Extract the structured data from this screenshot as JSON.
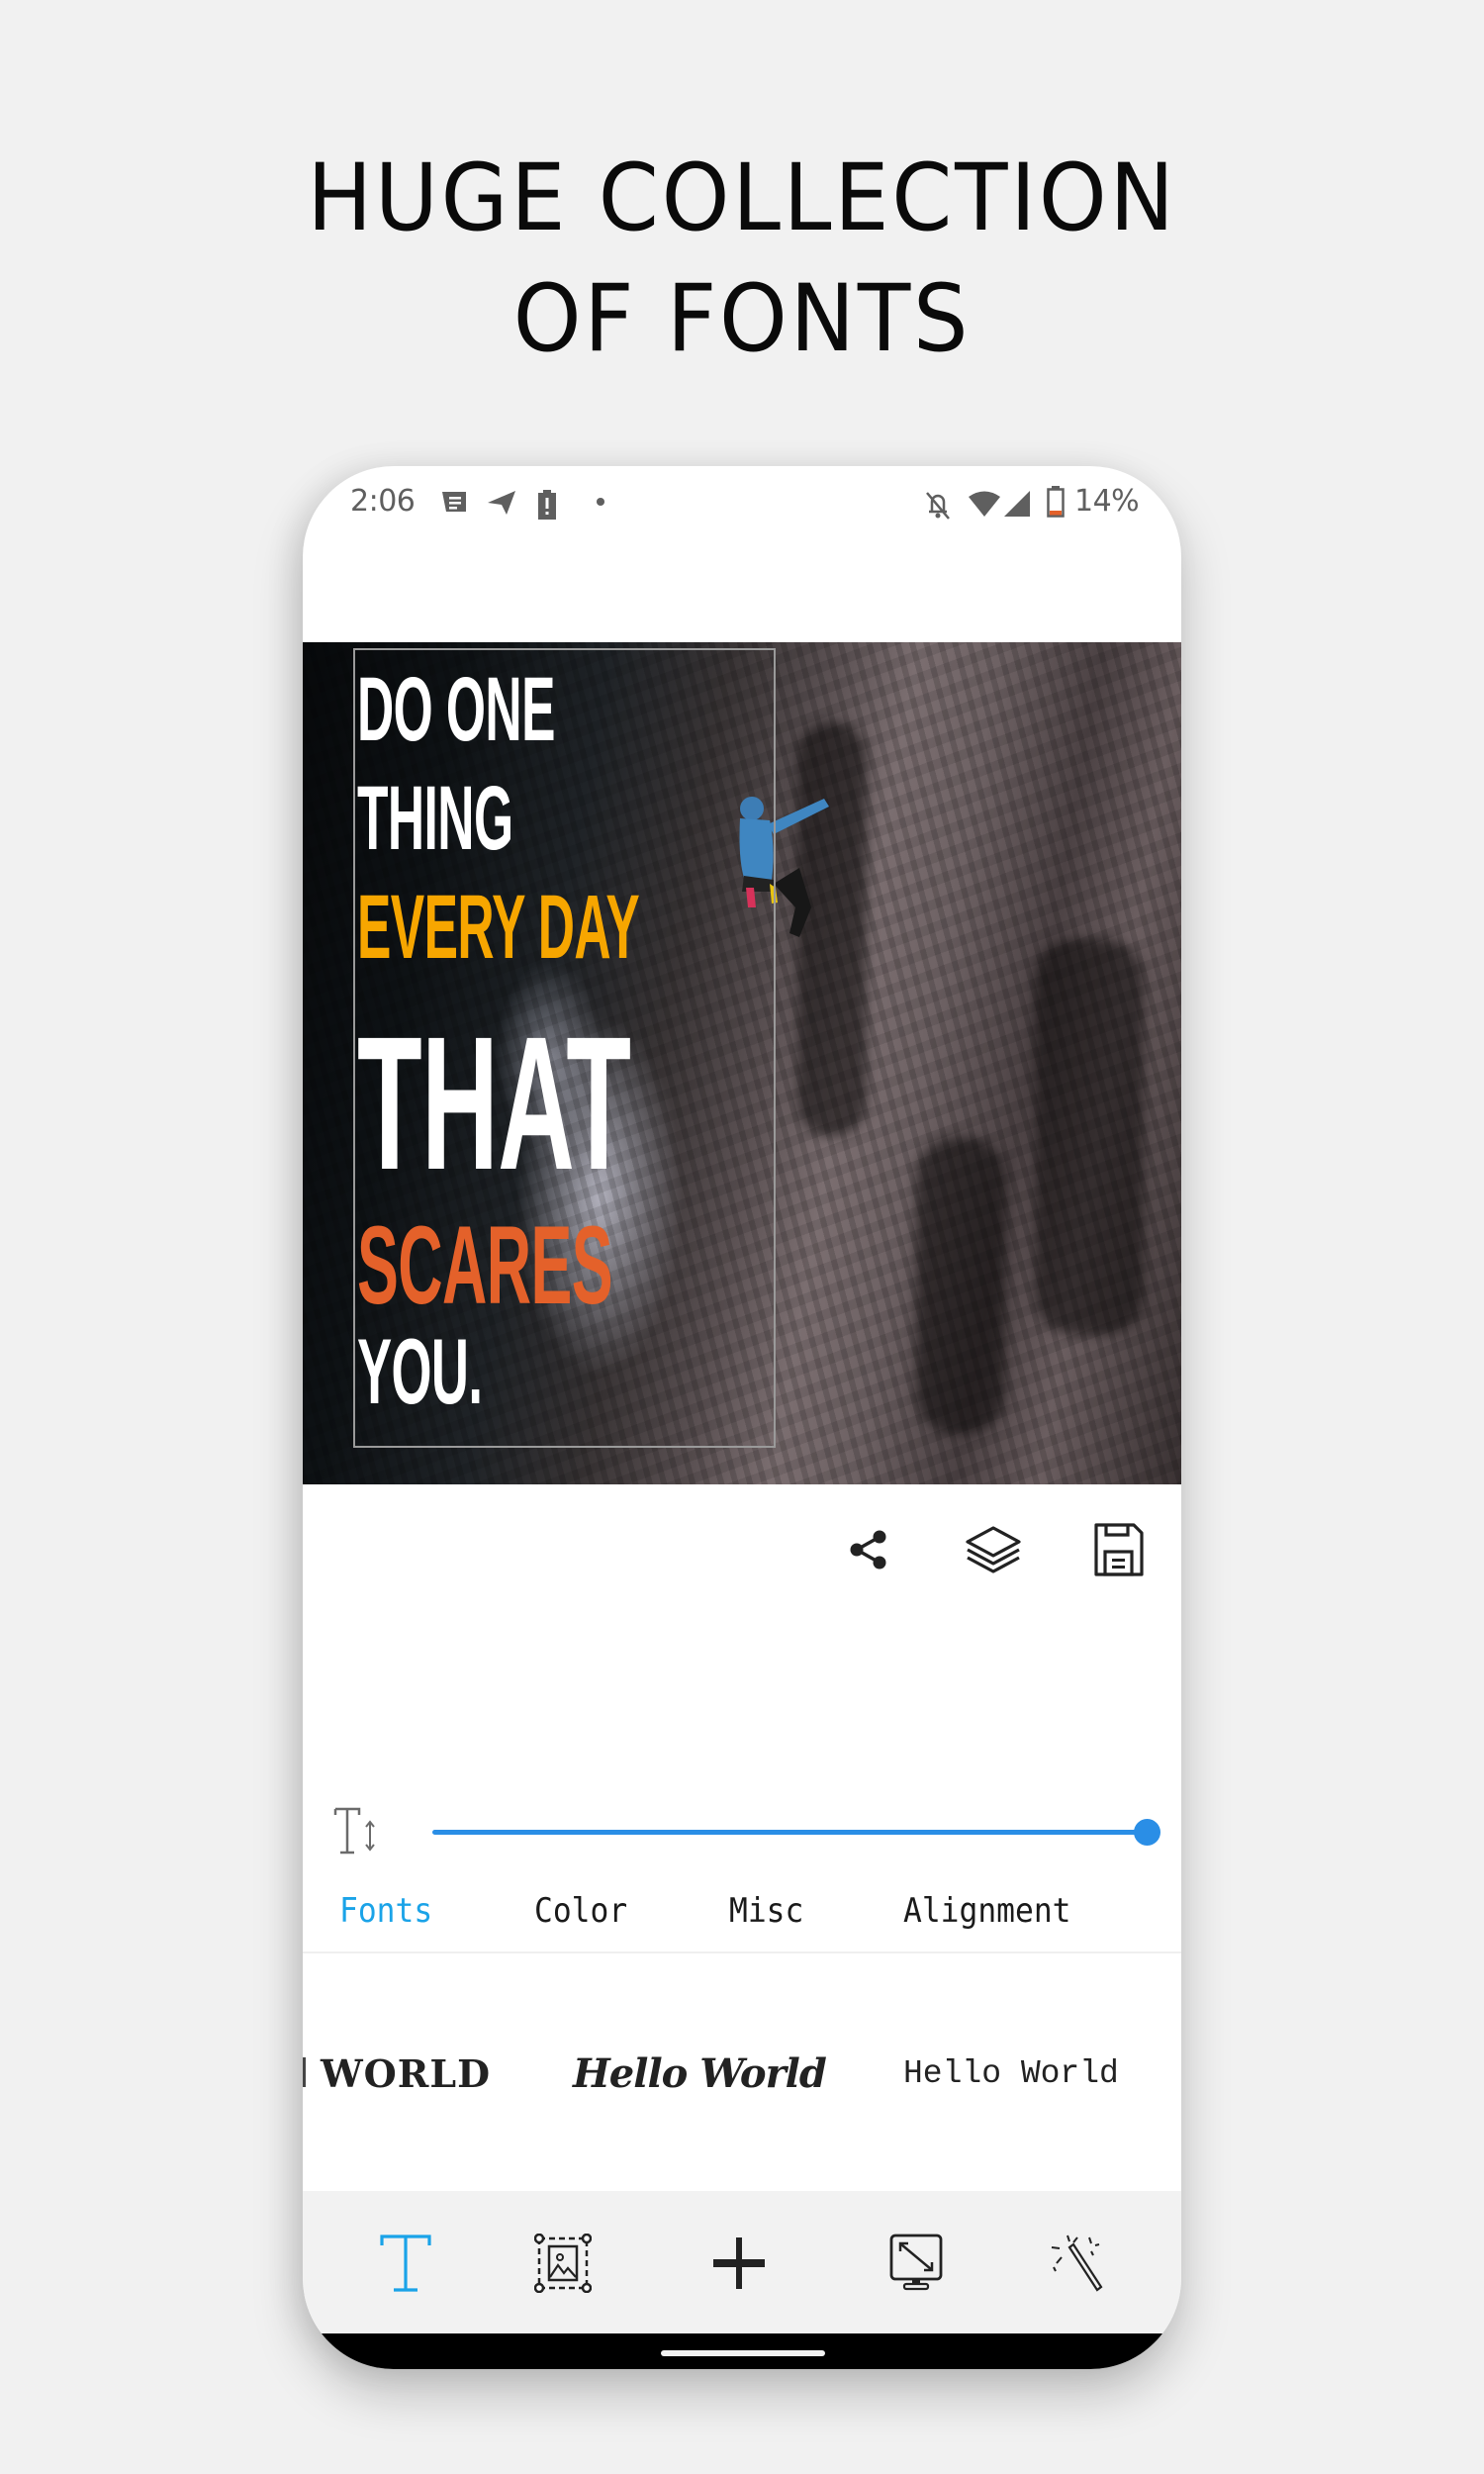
{
  "headline": {
    "line1": "HUGE COLLECTION",
    "line2": "OF FONTS"
  },
  "status_bar": {
    "time": "2:06",
    "left_icons": [
      "message-notification-icon",
      "telegram-icon",
      "battery-alert-icon",
      "dot-icon"
    ],
    "right_icons": [
      "notifications-off-icon",
      "wifi-icon",
      "cellular-signal-icon",
      "battery-icon"
    ],
    "battery_percent": "14%",
    "battery_level": 0.14,
    "battery_low_color": "#e4612a"
  },
  "canvas": {
    "quote_lines": [
      {
        "text": "DO ONE",
        "color": "#ffffff"
      },
      {
        "text": "THING",
        "color": "#ffffff"
      },
      {
        "text": "EVERY DAY",
        "color": "#f7a600"
      },
      {
        "text": "THAT",
        "color": "#ffffff"
      },
      {
        "text": "SCARES",
        "color": "#e4612a"
      },
      {
        "text": "YOU.",
        "color": "#ffffff"
      }
    ]
  },
  "actions": [
    {
      "name": "share",
      "icon": "share-icon"
    },
    {
      "name": "layers",
      "icon": "layers-icon"
    },
    {
      "name": "save",
      "icon": "save-icon"
    }
  ],
  "text_size": {
    "icon": "text-size-icon",
    "value_fraction": 1.0,
    "accent": "#2a8ee6"
  },
  "tabs": [
    {
      "label": "Fonts",
      "active": true
    },
    {
      "label": "Color",
      "active": false
    },
    {
      "label": "Misc",
      "active": false
    },
    {
      "label": "Alignment",
      "active": false
    }
  ],
  "tab_active_color": "#1aa3e8",
  "font_samples": [
    "WORLD",
    "Hello World",
    "Hello World"
  ],
  "toolbar": [
    {
      "name": "text",
      "icon": "text-tool-icon",
      "active": true
    },
    {
      "name": "image",
      "icon": "image-frame-icon",
      "active": false
    },
    {
      "name": "add",
      "icon": "plus-icon",
      "active": false
    },
    {
      "name": "resize",
      "icon": "resize-canvas-icon",
      "active": false
    },
    {
      "name": "effects",
      "icon": "magic-wand-icon",
      "active": false
    }
  ]
}
